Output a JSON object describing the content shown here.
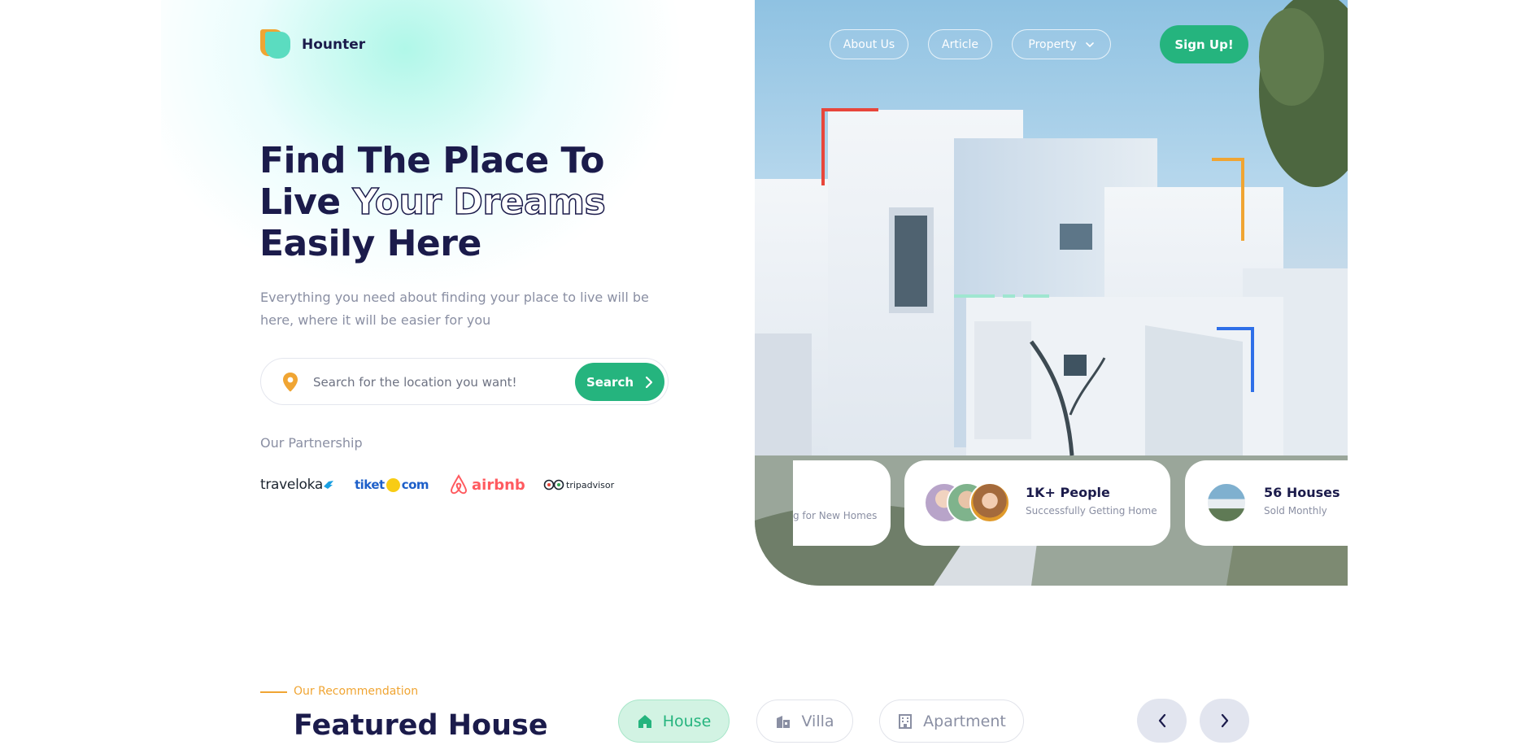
{
  "brand": {
    "name": "Hounter"
  },
  "nav": {
    "items": [
      "About Us",
      "Article",
      "Property"
    ],
    "signup_label": "Sign Up!"
  },
  "hero": {
    "title_line1": "Find The Place To",
    "title_line2_a": "Live",
    "title_line2_b": "Your Dreams",
    "title_line3": "Easily Here",
    "subtitle": "Everything you need about finding your place to live will be here, where it will be easier for you"
  },
  "search": {
    "placeholder": "Search for the location you want!",
    "button_label": "Search"
  },
  "partnership": {
    "title": "Our Partnership",
    "partners": [
      "traveloka",
      "tiket",
      "com",
      "airbnb",
      "tripadvisor"
    ]
  },
  "stats": [
    {
      "title": "",
      "subtitle": "g for New Homes"
    },
    {
      "title": "1K+ People",
      "subtitle": "Successfully Getting Home"
    },
    {
      "title": "56 Houses",
      "subtitle": "Sold Monthly"
    }
  ],
  "recommendation": {
    "label": "Our Recommendation",
    "title": "Featured House",
    "tabs": [
      "House",
      "Villa",
      "Apartment"
    ]
  },
  "colors": {
    "accent": "#25b47e",
    "brand_dark": "#1b1b4b",
    "orange": "#f0a533"
  }
}
